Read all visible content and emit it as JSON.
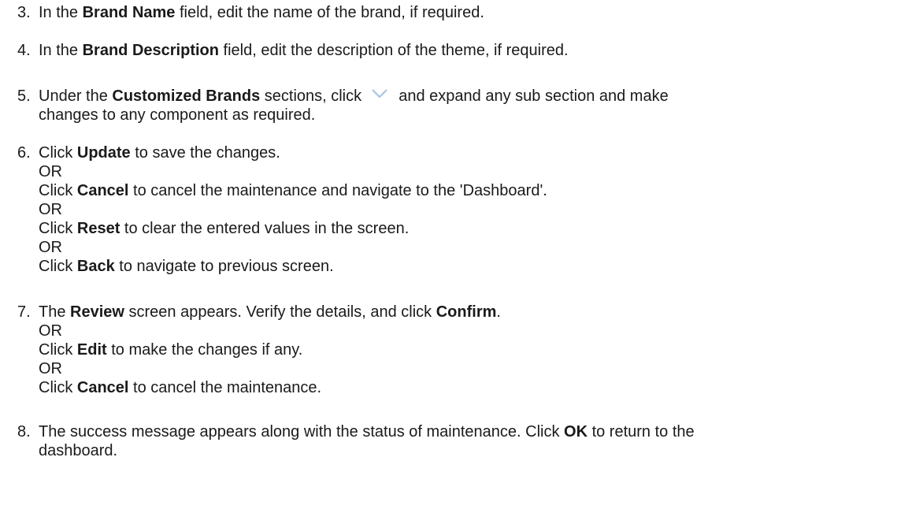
{
  "steps": [
    {
      "number": "3.",
      "lines": [
        {
          "pre": "In the ",
          "bold": "Brand Name",
          "post": " field, edit the name of the brand, if required."
        }
      ]
    },
    {
      "number": "4.",
      "lines": [
        {
          "pre": "In the ",
          "bold": "Brand Description",
          "post": " field, edit the description of the theme, if required."
        }
      ]
    },
    {
      "number": "5.",
      "lines": [
        {
          "pre": "Under the ",
          "bold": "Customized Brands",
          "post1": " sections, click ",
          "icon": "chevron-down-icon",
          "post2": " and expand any sub section and make"
        },
        {
          "text": "changes to any component as required."
        }
      ]
    },
    {
      "number": "6.",
      "lines": [
        {
          "pre": "Click ",
          "bold": "Update",
          "post": " to save the changes."
        },
        {
          "text": "OR"
        },
        {
          "pre": "Click ",
          "bold": "Cancel",
          "post": " to cancel the maintenance and navigate to the 'Dashboard'."
        },
        {
          "text": "OR"
        },
        {
          "pre": "Click ",
          "bold": "Reset",
          "post": " to clear the entered values in the screen."
        },
        {
          "text": "OR"
        },
        {
          "pre": "Click ",
          "bold": "Back",
          "post": " to navigate to previous screen."
        }
      ]
    },
    {
      "number": "7.",
      "lines": [
        {
          "pre": "The ",
          "bold": "Review",
          "mid": " screen appears. Verify the details, and click ",
          "bold2": "Confirm",
          "post": "."
        },
        {
          "text": "OR"
        },
        {
          "pre": "Click ",
          "bold": "Edit",
          "post": " to make the changes if any."
        },
        {
          "text": "OR"
        },
        {
          "pre": "Click ",
          "bold": "Cancel",
          "post": " to cancel the maintenance."
        }
      ]
    },
    {
      "number": "8.",
      "lines": [
        {
          "pre": "The success message appears along with the status of maintenance. Click ",
          "bold": "OK",
          "post": " to return to the"
        },
        {
          "text": "dashboard."
        }
      ]
    }
  ],
  "icon_color": "#a9c4e6"
}
